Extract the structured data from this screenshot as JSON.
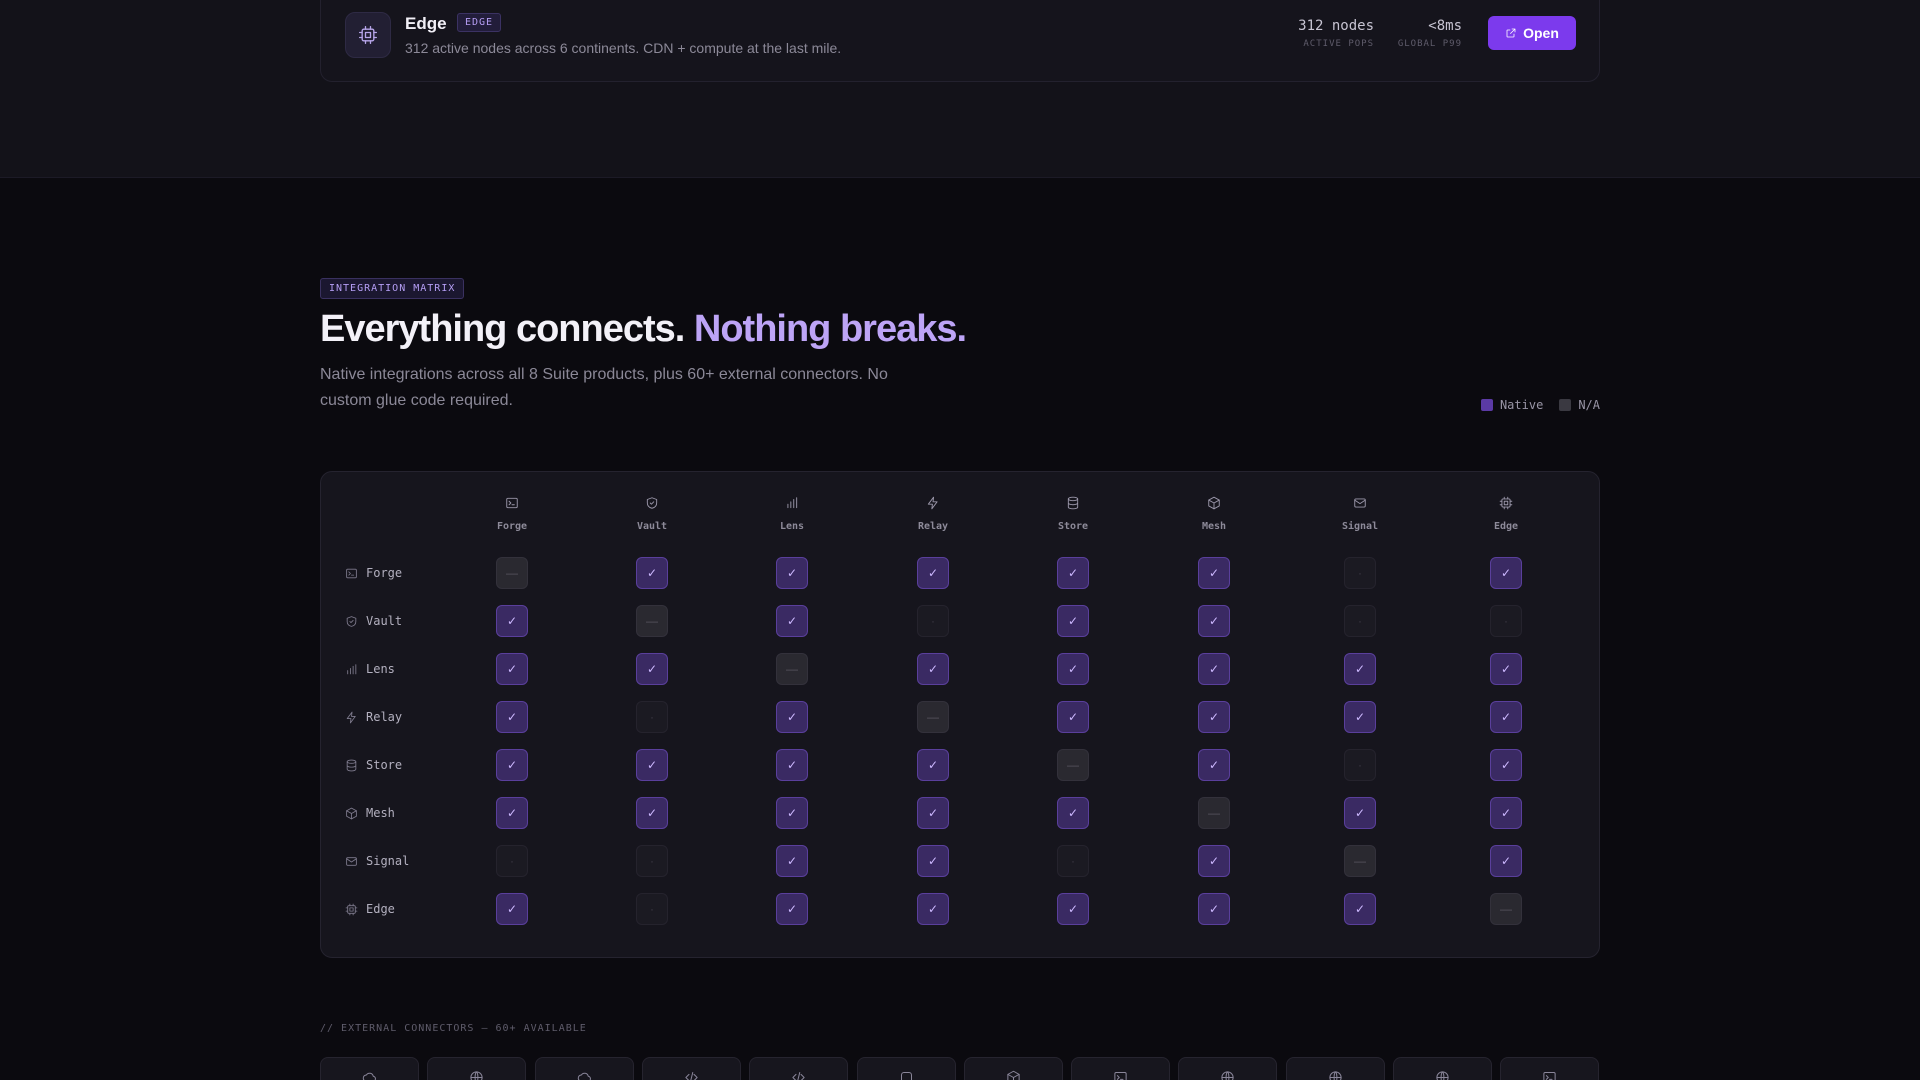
{
  "product_card": {
    "title": "Edge",
    "badge": "EDGE",
    "description": "312 active nodes across 6 continents. CDN + compute at the last mile.",
    "stats": [
      {
        "value": "312 nodes",
        "label": "ACTIVE POPS"
      },
      {
        "value": "<8ms",
        "label": "GLOBAL P99"
      }
    ],
    "open_label": "Open"
  },
  "matrix_section": {
    "tag": "INTEGRATION MATRIX",
    "headline_a": "Everything connects.",
    "headline_b": "Nothing breaks.",
    "subtext": "Native integrations across all 8 Suite products, plus 60+ external connectors. No custom glue code required.",
    "legend": [
      {
        "label": "Native",
        "color": "#5b3aa5"
      },
      {
        "label": "N/A",
        "color": "#3a3941"
      }
    ]
  },
  "products": [
    {
      "name": "Forge",
      "icon": "terminal-icon"
    },
    {
      "name": "Vault",
      "icon": "shield-icon"
    },
    {
      "name": "Lens",
      "icon": "bar-chart-icon"
    },
    {
      "name": "Relay",
      "icon": "bolt-icon"
    },
    {
      "name": "Store",
      "icon": "database-icon"
    },
    {
      "name": "Mesh",
      "icon": "cube-icon"
    },
    {
      "name": "Signal",
      "icon": "mail-icon"
    },
    {
      "name": "Edge",
      "icon": "chip-icon"
    }
  ],
  "matrix": [
    [
      "self",
      "native",
      "native",
      "native",
      "native",
      "native",
      "na",
      "native"
    ],
    [
      "native",
      "self",
      "native",
      "na",
      "native",
      "native",
      "na",
      "na"
    ],
    [
      "native",
      "native",
      "self",
      "native",
      "native",
      "native",
      "native",
      "native"
    ],
    [
      "native",
      "na",
      "native",
      "self",
      "native",
      "native",
      "native",
      "native"
    ],
    [
      "native",
      "native",
      "native",
      "native",
      "self",
      "native",
      "na",
      "native"
    ],
    [
      "native",
      "native",
      "native",
      "native",
      "native",
      "self",
      "native",
      "native"
    ],
    [
      "na",
      "na",
      "native",
      "native",
      "na",
      "native",
      "self",
      "native"
    ],
    [
      "native",
      "na",
      "native",
      "native",
      "native",
      "native",
      "native",
      "self"
    ]
  ],
  "symbols": {
    "native": "✓",
    "self": "—",
    "na": "·"
  },
  "external": {
    "label": "// EXTERNAL CONNECTORS — 60+ AVAILABLE",
    "connectors": [
      {
        "icon": "cloud-icon"
      },
      {
        "icon": "globe-icon"
      },
      {
        "icon": "cloud-icon"
      },
      {
        "icon": "code-icon"
      },
      {
        "icon": "code-icon"
      },
      {
        "icon": "box-icon"
      },
      {
        "icon": "cube-icon"
      },
      {
        "icon": "terminal-icon"
      },
      {
        "icon": "globe-icon"
      },
      {
        "icon": "globe-icon"
      },
      {
        "icon": "globe-icon"
      },
      {
        "icon": "terminal-icon"
      }
    ]
  },
  "colors": {
    "accent": "#7c3aed",
    "accent_light": "#bda4f6",
    "native_cell": "#3a2a63"
  }
}
